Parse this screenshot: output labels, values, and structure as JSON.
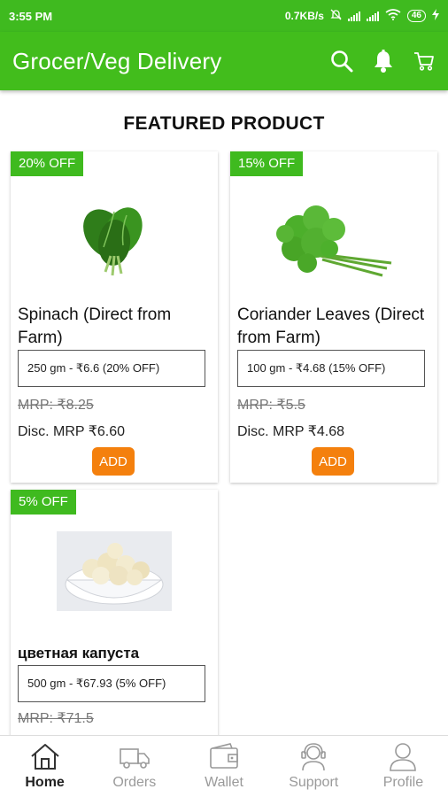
{
  "status_bar": {
    "time": "3:55 PM",
    "speed": "0.7KB/s",
    "battery": "46",
    "icons": [
      "alarm-off-icon",
      "signal-icon",
      "signal-icon",
      "wifi-icon",
      "battery-icon",
      "charging-icon"
    ]
  },
  "app_bar": {
    "title": "Grocer/Veg Delivery",
    "icons": [
      "search-icon",
      "bell-icon",
      "cart-icon"
    ]
  },
  "section_title": "FEATURED PRODUCT",
  "products": [
    {
      "badge": "20% OFF",
      "name": "Spinach (Direct from Farm)",
      "variant": "250 gm - ₹6.6 (20% OFF)",
      "mrp": "MRP: ₹8.25",
      "disc": "Disc. MRP ₹6.60",
      "add_label": "ADD",
      "image": "spinach-image"
    },
    {
      "badge": "15% OFF",
      "name": "Coriander Leaves (Direct from Farm)",
      "variant": "100 gm - ₹4.68 (15% OFF)",
      "mrp": "MRP: ₹5.5",
      "disc": "Disc. MRP ₹4.68",
      "add_label": "ADD",
      "image": "coriander-image"
    },
    {
      "badge": "5% OFF",
      "name": "цветная капуста",
      "variant": "500 gm - ₹67.93 (5% OFF)",
      "mrp": "MRP: ₹71.5",
      "image": "cauliflower-image"
    }
  ],
  "bottom_nav": [
    {
      "label": "Home",
      "icon": "home-icon",
      "active": true
    },
    {
      "label": "Orders",
      "icon": "truck-icon",
      "active": false
    },
    {
      "label": "Wallet",
      "icon": "wallet-icon",
      "active": false
    },
    {
      "label": "Support",
      "icon": "headset-icon",
      "active": false
    },
    {
      "label": "Profile",
      "icon": "user-icon",
      "active": false
    }
  ],
  "colors": {
    "primary": "#42bd1c",
    "badge": "#3fba1f",
    "add_button": "#f4800d"
  }
}
